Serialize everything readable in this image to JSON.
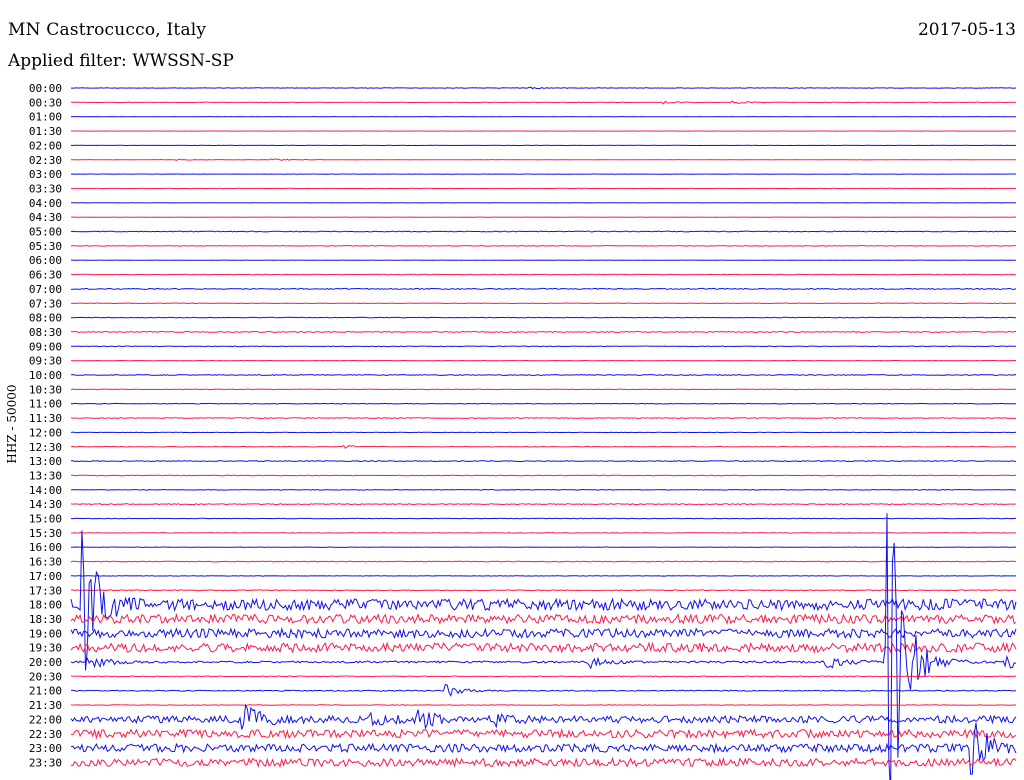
{
  "header": {
    "station": "MN Castrocucco, Italy",
    "date": "2017-05-13",
    "filter": "Applied filter: WWSSN-SP",
    "channel": "HHZ - 50000"
  },
  "colors": {
    "trace_a": "#1010ee",
    "trace_b": "#ff1a4a",
    "background": "#ffffff",
    "text": "#000000"
  },
  "chart_data": {
    "type": "line",
    "title": "MN Castrocucco, Italy",
    "subtitle": "Applied filter: WWSSN-SP",
    "ylabel": "HHZ - 50000",
    "xlim_minutes": [
      0,
      30
    ],
    "grid": false,
    "row_labels": [
      "00:00",
      "00:30",
      "01:00",
      "01:30",
      "02:00",
      "02:30",
      "03:00",
      "03:30",
      "04:00",
      "04:30",
      "05:00",
      "05:30",
      "06:00",
      "06:30",
      "07:00",
      "07:30",
      "08:00",
      "08:30",
      "09:00",
      "09:30",
      "10:00",
      "10:30",
      "11:00",
      "11:30",
      "12:00",
      "12:30",
      "13:00",
      "13:30",
      "14:00",
      "14:30",
      "15:00",
      "15:30",
      "16:00",
      "16:30",
      "17:00",
      "17:30",
      "18:00",
      "18:30",
      "19:00",
      "19:30",
      "20:00",
      "20:30",
      "21:00",
      "21:30",
      "22:00",
      "22:30",
      "23:00",
      "23:30"
    ],
    "noise_amplitude": [
      0.2,
      0.25,
      0.1,
      0.1,
      0.15,
      0.12,
      0.1,
      0.15,
      0.12,
      0.1,
      0.4,
      0.3,
      0.15,
      0.3,
      0.55,
      0.25,
      0.3,
      0.5,
      0.3,
      0.2,
      0.45,
      0.3,
      0.3,
      0.4,
      0.2,
      0.3,
      0.4,
      0.3,
      0.3,
      0.45,
      0.25,
      0.25,
      0.2,
      0.4,
      0.2,
      0.4,
      5.5,
      4.5,
      4.5,
      4.5,
      1.0,
      0.4,
      0.5,
      0.3,
      3.5,
      4.0,
      4.0,
      4.0
    ],
    "events": [
      {
        "row": 0,
        "minute": 14.5,
        "amp": 1.2
      },
      {
        "row": 1,
        "minute": 18.8,
        "amp": 1.5
      },
      {
        "row": 1,
        "minute": 21.0,
        "amp": 1.2
      },
      {
        "row": 5,
        "minute": 3.3,
        "amp": 1.2
      },
      {
        "row": 5,
        "minute": 6.3,
        "amp": 1.5
      },
      {
        "row": 25,
        "minute": 8.6,
        "amp": 2.0
      },
      {
        "row": 36,
        "minute": 0.3,
        "amp": 90
      },
      {
        "row": 40,
        "minute": 0.5,
        "amp": 10
      },
      {
        "row": 40,
        "minute": 16.4,
        "amp": 7
      },
      {
        "row": 40,
        "minute": 23.9,
        "amp": 12
      },
      {
        "row": 40,
        "minute": 25.8,
        "amp": 260
      },
      {
        "row": 40,
        "minute": 29.6,
        "amp": 12
      },
      {
        "row": 42,
        "minute": 11.8,
        "amp": 9
      },
      {
        "row": 44,
        "minute": 5.4,
        "amp": 20
      },
      {
        "row": 44,
        "minute": 9.5,
        "amp": 6
      },
      {
        "row": 44,
        "minute": 11.0,
        "amp": 9
      },
      {
        "row": 44,
        "minute": 13.5,
        "amp": 5
      },
      {
        "row": 46,
        "minute": 28.5,
        "amp": 40
      },
      {
        "row": 38,
        "minute": 31.0,
        "amp": 15
      }
    ]
  }
}
